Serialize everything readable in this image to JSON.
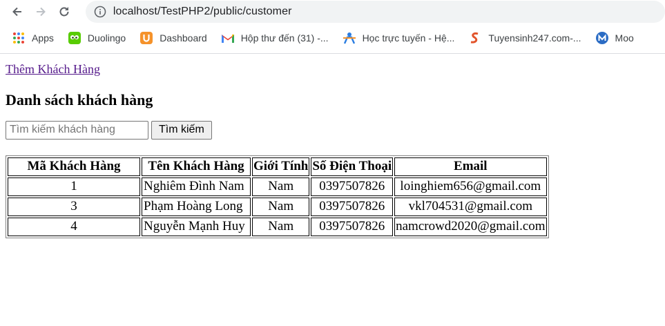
{
  "browser": {
    "url": "localhost/TestPHP2/public/customer",
    "bookmarks": [
      {
        "label": "Apps",
        "icon": "apps-grid-icon"
      },
      {
        "label": "Duolingo",
        "icon": "duolingo-icon"
      },
      {
        "label": "Dashboard",
        "icon": "dashboard-u-icon"
      },
      {
        "label": "Hộp thư đến (31) -...",
        "icon": "gmail-icon"
      },
      {
        "label": "Học trực tuyến - Hệ...",
        "icon": "learning-icon"
      },
      {
        "label": "Tuyensinh247.com-...",
        "icon": "tuyensinh-icon"
      },
      {
        "label": "Moo",
        "icon": "moodle-icon"
      }
    ]
  },
  "page": {
    "add_link": "Thêm Khách Hàng",
    "title": "Danh sách khách hàng",
    "search": {
      "placeholder": "Tìm kiếm khách hàng",
      "value": "",
      "button": "Tìm kiếm"
    },
    "table": {
      "headers": [
        "Mã Khách Hàng",
        "Tên Khách Hàng",
        "Giới Tính",
        "Số Điện Thoại",
        "Email"
      ],
      "rows": [
        [
          "1",
          "Nghiêm Đình Nam",
          "Nam",
          "0397507826",
          "loinghiem656@gmail.com"
        ],
        [
          "3",
          "Phạm Hoàng Long",
          "Nam",
          "0397507826",
          "vkl704531@gmail.com"
        ],
        [
          "4",
          "Nguyễn Mạnh Huy",
          "Nam",
          "0397507826",
          "namcrowd2020@gmail.com"
        ]
      ]
    }
  }
}
